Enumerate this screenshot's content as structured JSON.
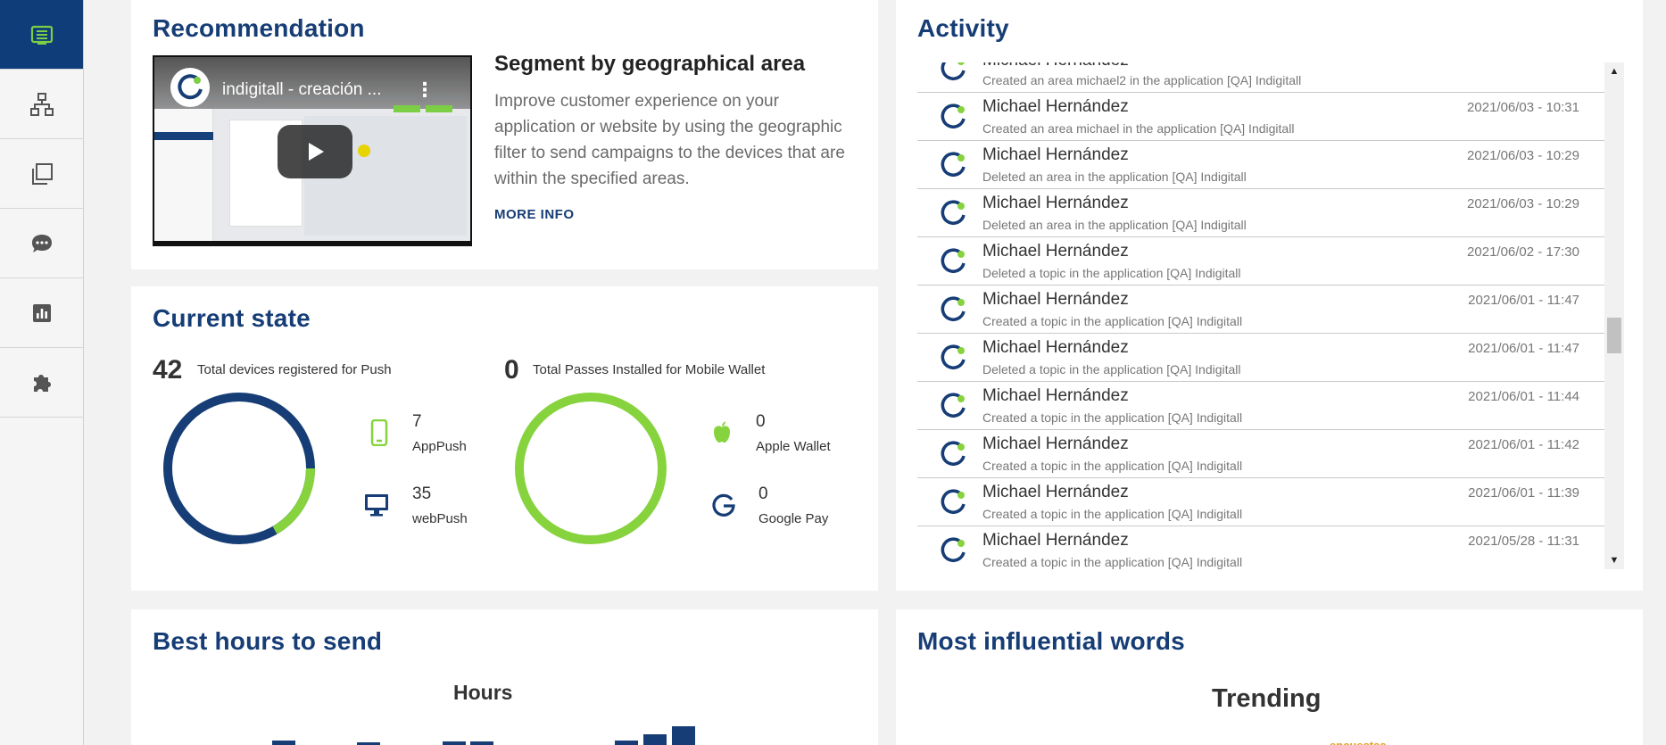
{
  "sidebar": {
    "items": [
      {
        "name": "sidebar-item-dashboard",
        "icon": "list-icon",
        "active": true
      },
      {
        "name": "sidebar-item-network",
        "icon": "sitemap-icon",
        "active": false
      },
      {
        "name": "sidebar-item-copies",
        "icon": "copy-icon",
        "active": false
      },
      {
        "name": "sidebar-item-messages",
        "icon": "chat-icon",
        "active": false
      },
      {
        "name": "sidebar-item-stats",
        "icon": "chart-icon",
        "active": false
      },
      {
        "name": "sidebar-item-plugins",
        "icon": "puzzle-icon",
        "active": false
      }
    ]
  },
  "recommendation": {
    "title": "Recommendation",
    "video_title": "indigitall - creación ...",
    "heading": "Segment by geographical area",
    "description": "Improve customer experience on your application or website by using the geographic filter to send campaigns to the devices that are within the specified areas.",
    "more_info": "MORE INFO"
  },
  "current_state": {
    "title": "Current state",
    "push": {
      "total": "42",
      "total_label": "Total devices registered for Push",
      "app_value": "7",
      "app_label": "AppPush",
      "web_value": "35",
      "web_label": "webPush",
      "app_count": 7,
      "web_count": 35
    },
    "wallet": {
      "total": "0",
      "total_label": "Total Passes Installed for Mobile Wallet",
      "apple_value": "0",
      "apple_label": "Apple Wallet",
      "google_value": "0",
      "google_label": "Google Pay"
    },
    "colors": {
      "navy": "#163d76",
      "green": "#86d33e"
    }
  },
  "activity": {
    "title": "Activity",
    "rows": [
      {
        "name": "Michael Hernández",
        "text": "Created an area michael2 in the application [QA] Indigitall",
        "time": ""
      },
      {
        "name": "Michael Hernández",
        "text": "Created an area michael in the application [QA] Indigitall",
        "time": "2021/06/03 - 10:31"
      },
      {
        "name": "Michael Hernández",
        "text": "Deleted an area in the application [QA] Indigitall",
        "time": "2021/06/03 - 10:29"
      },
      {
        "name": "Michael Hernández",
        "text": "Deleted an area in the application [QA] Indigitall",
        "time": "2021/06/03 - 10:29"
      },
      {
        "name": "Michael Hernández",
        "text": "Deleted a topic in the application [QA] Indigitall",
        "time": "2021/06/02 - 17:30"
      },
      {
        "name": "Michael Hernández",
        "text": "Created a topic in the application [QA] Indigitall",
        "time": "2021/06/01 - 11:47"
      },
      {
        "name": "Michael Hernández",
        "text": "Deleted a topic in the application [QA] Indigitall",
        "time": "2021/06/01 - 11:47"
      },
      {
        "name": "Michael Hernández",
        "text": "Created a topic in the application [QA] Indigitall",
        "time": "2021/06/01 - 11:44"
      },
      {
        "name": "Michael Hernández",
        "text": "Created a topic in the application [QA] Indigitall",
        "time": "2021/06/01 - 11:42"
      },
      {
        "name": "Michael Hernández",
        "text": "Created a topic in the application [QA] Indigitall",
        "time": "2021/06/01 - 11:39"
      },
      {
        "name": "Michael Hernández",
        "text": "Created a topic in the application [QA] Indigitall",
        "time": "2021/05/28 - 11:31"
      }
    ]
  },
  "best_hours": {
    "title": "Best hours to send",
    "chart_title": "Hours"
  },
  "influential_words": {
    "title": "Most influential words",
    "chart_title": "Trending",
    "word_fragment": "encuestas"
  }
}
